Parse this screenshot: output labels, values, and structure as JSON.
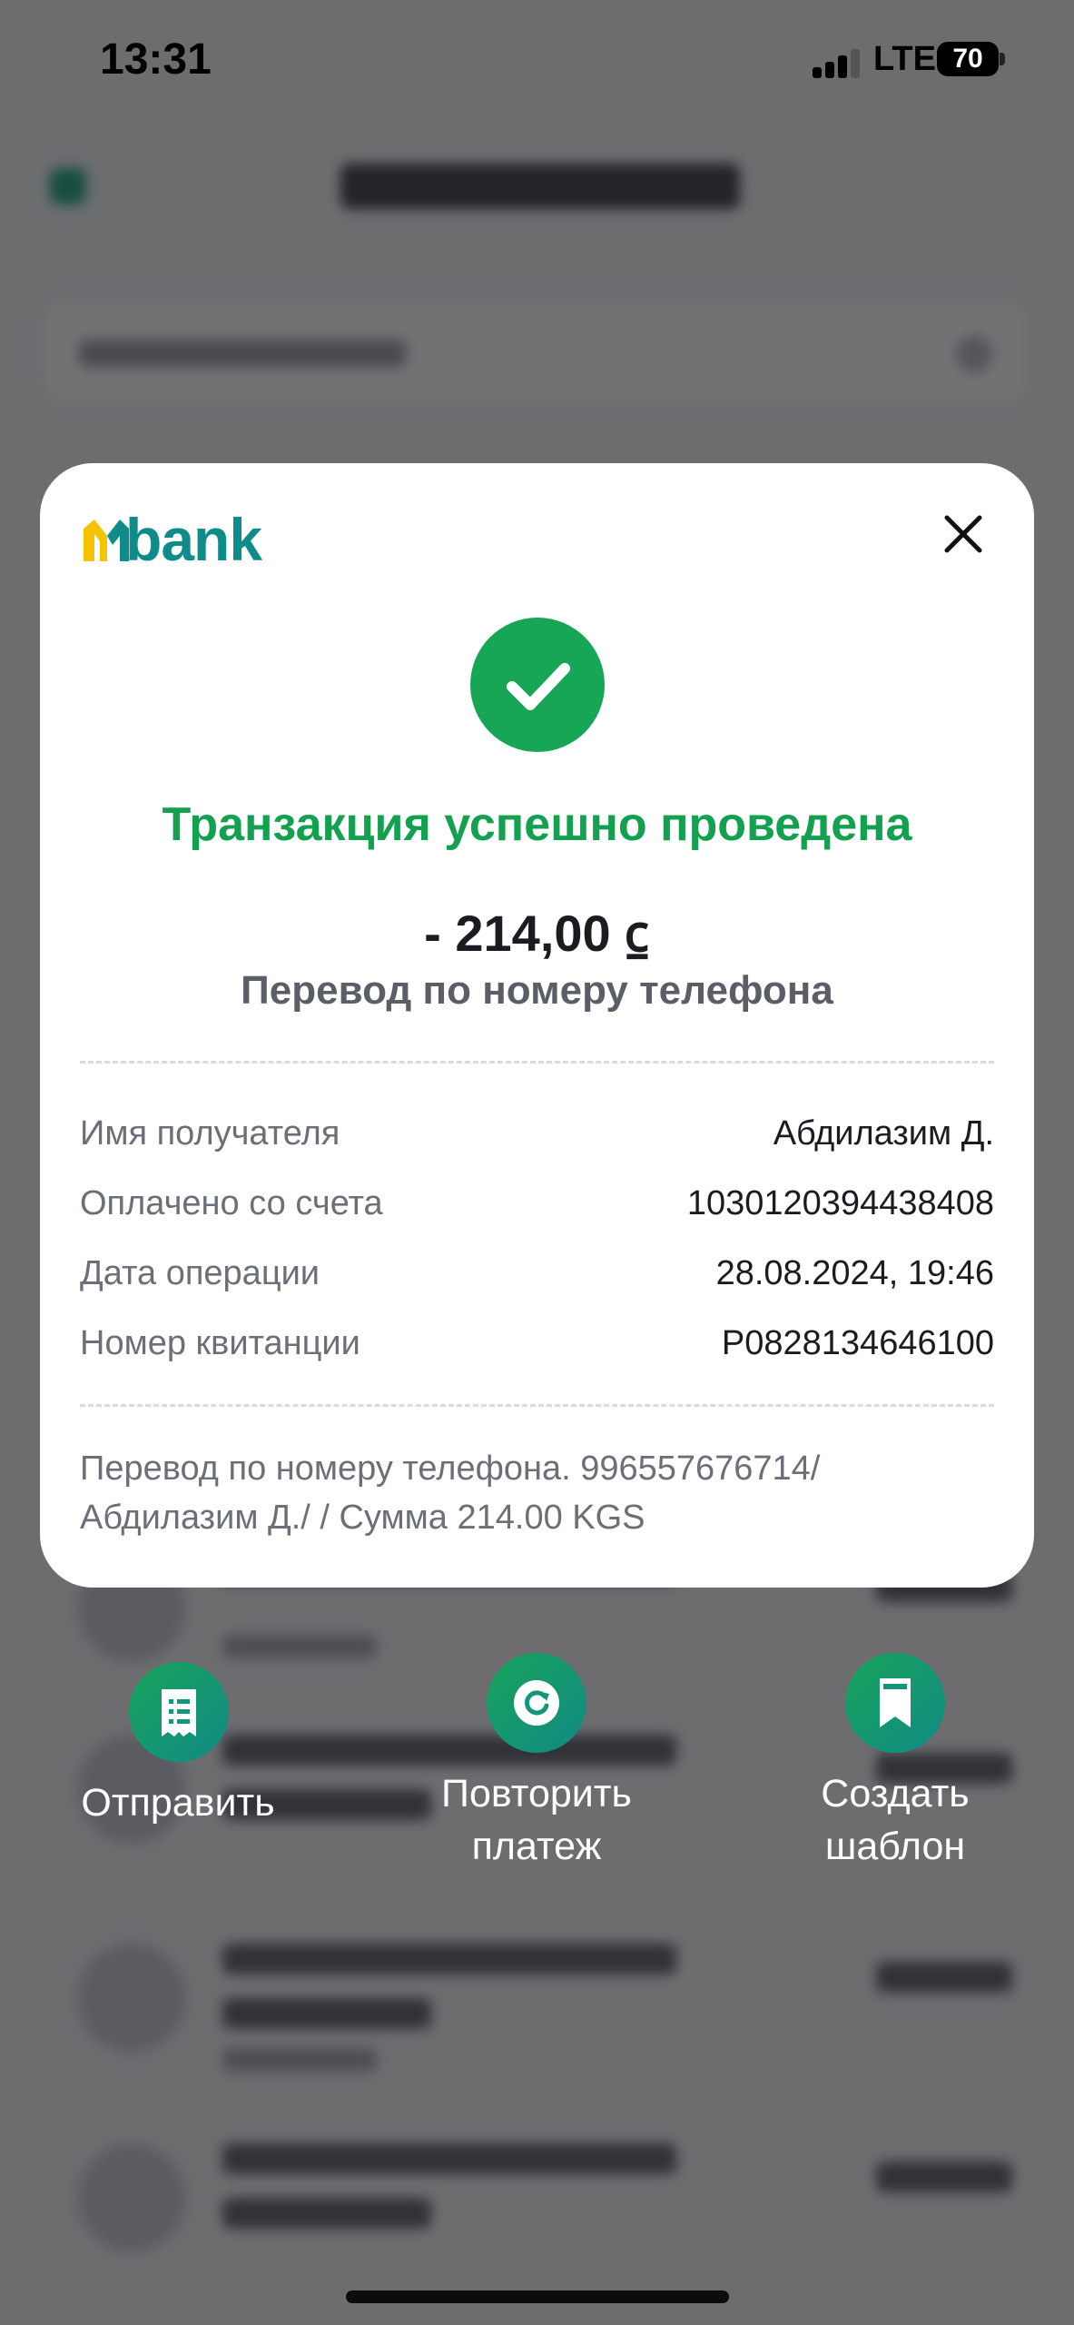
{
  "status_bar": {
    "time": "13:31",
    "network": "LTE",
    "battery": "70"
  },
  "receipt": {
    "brand": "bank",
    "success_title": "Транзакция успешно проведена",
    "amount": "- 214,00 ⃀",
    "operation_type": "Перевод по номеру телефона",
    "details": [
      {
        "label": "Имя получателя",
        "value": "Абдилазим Д."
      },
      {
        "label": "Оплачено со счета",
        "value": "1030120394438408"
      },
      {
        "label": "Дата операции",
        "value": "28.08.2024, 19:46"
      },
      {
        "label": "Номер квитанции",
        "value": "P0828134646100"
      }
    ],
    "comment_line1": "Перевод по номеру телефона. 996557676714/",
    "comment_line2": "Абдилазим Д./ / Сумма 214.00 KGS"
  },
  "actions": {
    "send": {
      "line1": "Отправить"
    },
    "repeat": {
      "line1": "Повторить",
      "line2": "платеж"
    },
    "template": {
      "line1": "Создать",
      "line2": "шаблон"
    }
  },
  "colors": {
    "success_green": "#17a556",
    "brand_teal": "#0f8c8a",
    "brand_yellow": "#f5c400",
    "overlay": "#5f5f61"
  },
  "icons": {
    "close": "close-icon",
    "success": "checkmark-icon",
    "send": "receipt-icon",
    "repeat": "refresh-icon",
    "template": "bookmark-icon"
  }
}
